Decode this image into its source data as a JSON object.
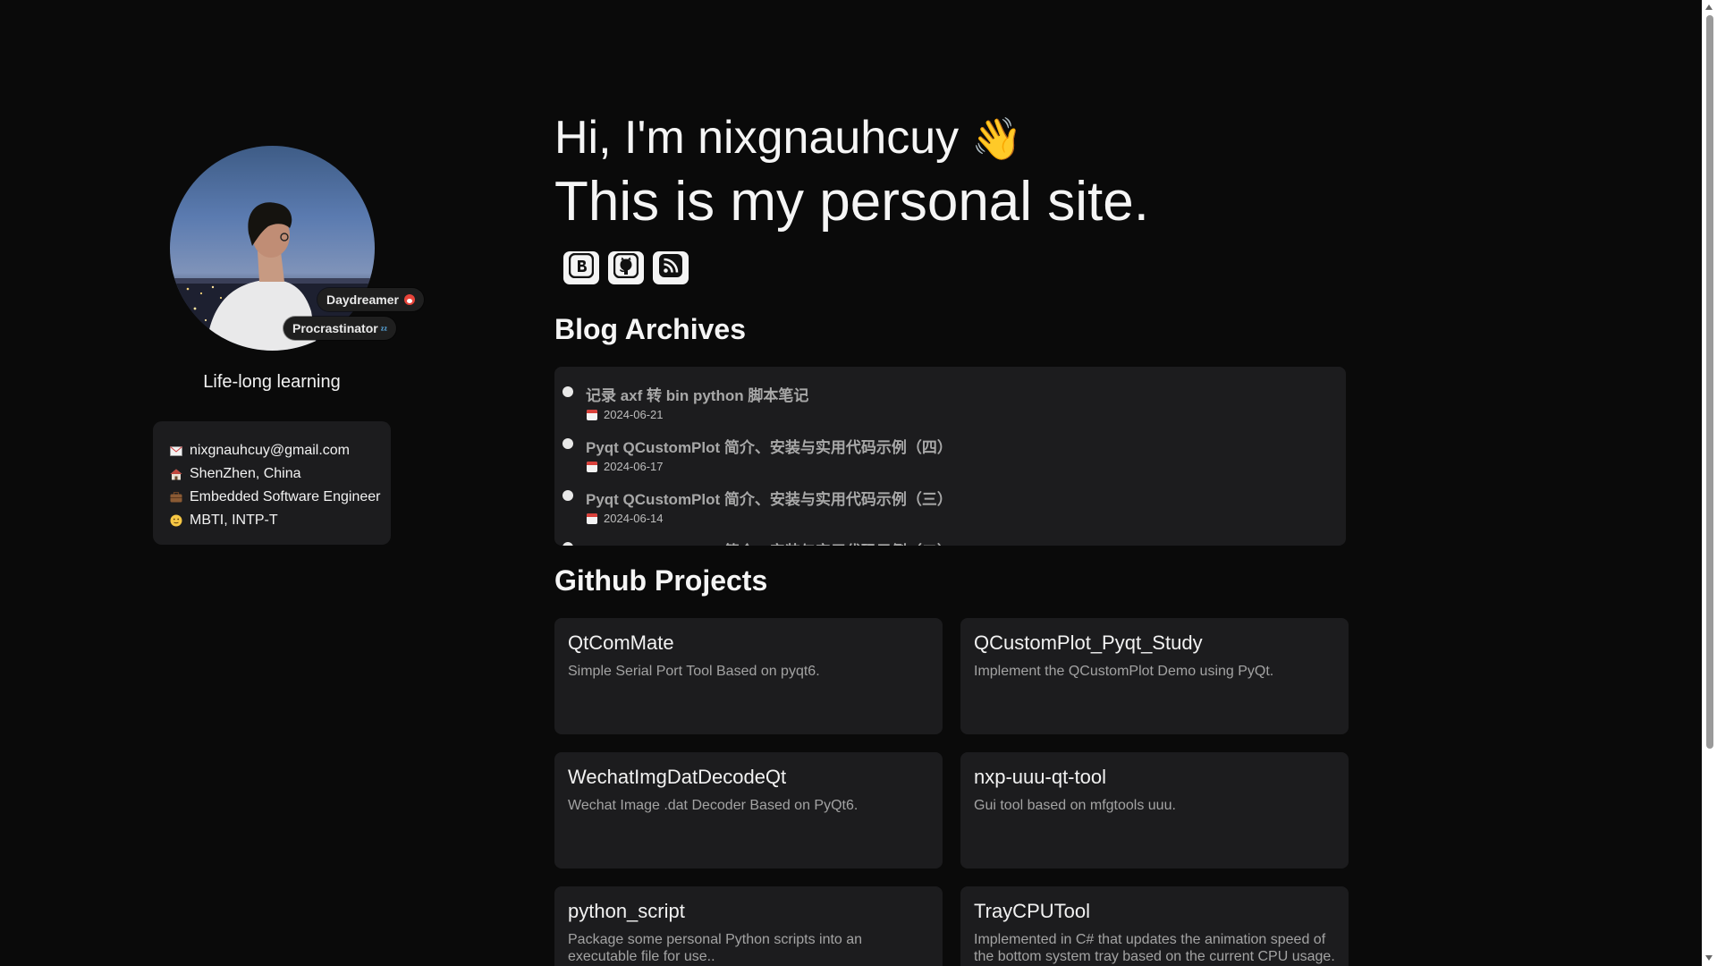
{
  "profile": {
    "tag_1": "Daydreamer",
    "tag_1_icon": "tongue-face-emoji",
    "tag_2": "Procrastinator",
    "tag_2_icon": "zzz-emoji",
    "motto": "Life-long learning",
    "info": [
      {
        "icon": "envelope-icon",
        "text": "nixgnauhcuy@gmail.com"
      },
      {
        "icon": "house-icon",
        "text": "ShenZhen, China"
      },
      {
        "icon": "briefcase-icon",
        "text": "Embedded Software Engineer"
      },
      {
        "icon": "smiley-icon",
        "text": "MBTI, INTP-T"
      }
    ]
  },
  "hero": {
    "line_1": "Hi, I'm nixgnauhcuy",
    "wave": "👋",
    "line_2": "This is my personal site."
  },
  "social": [
    {
      "icon": "blogger-icon"
    },
    {
      "icon": "github-icon"
    },
    {
      "icon": "rss-icon"
    }
  ],
  "blog": {
    "title": "Blog Archives",
    "posts": [
      {
        "title": "记录 axf 转 bin python 脚本笔记",
        "date": "2024-06-21"
      },
      {
        "title": "Pyqt QCustomPlot 简介、安装与实用代码示例（四）",
        "date": "2024-06-17"
      },
      {
        "title": "Pyqt QCustomPlot 简介、安装与实用代码示例（三）",
        "date": "2024-06-14"
      },
      {
        "title": "Pyqt QCustomPlot 简介、安装与实用代码示例（二）",
        "date": ""
      }
    ]
  },
  "github": {
    "title": "Github Projects",
    "projects": [
      {
        "name": "QtComMate",
        "desc": "Simple Serial Port Tool Based on pyqt6."
      },
      {
        "name": "QCustomPlot_Pyqt_Study",
        "desc": "Implement the QCustomPlot Demo using PyQt."
      },
      {
        "name": "WechatImgDatDecodeQt",
        "desc": "Wechat Image .dat Decoder Based on PyQt6."
      },
      {
        "name": "nxp-uuu-qt-tool",
        "desc": "Gui tool based on mfgtools uuu."
      },
      {
        "name": "python_script",
        "desc": "Package some personal Python scripts into an executable file for use.."
      },
      {
        "name": "TrayCPUTool",
        "desc": "Implemented in C# that updates the animation speed of the bottom system tray based on the current CPU usage."
      }
    ]
  }
}
